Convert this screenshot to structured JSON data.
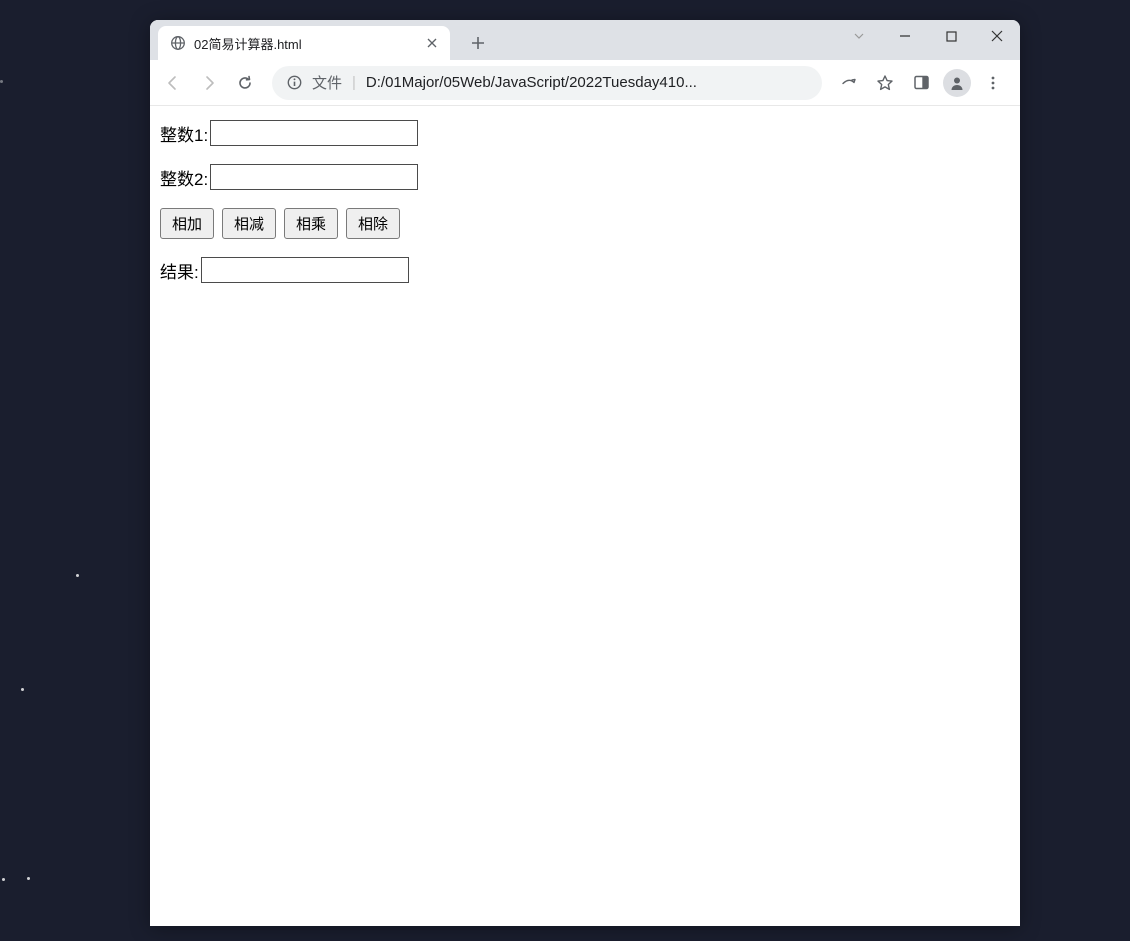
{
  "window": {
    "tab_title": "02简易计算器.html",
    "new_tab_tooltip": "+"
  },
  "address": {
    "file_label": "文件",
    "url": "D:/01Major/05Web/JavaScript/2022Tuesday410..."
  },
  "page": {
    "int1_label": "整数1:",
    "int2_label": "整数2:",
    "result_label": "结果:",
    "int1_value": "",
    "int2_value": "",
    "result_value": "",
    "buttons": {
      "add": "相加",
      "sub": "相减",
      "mul": "相乘",
      "div": "相除"
    }
  }
}
